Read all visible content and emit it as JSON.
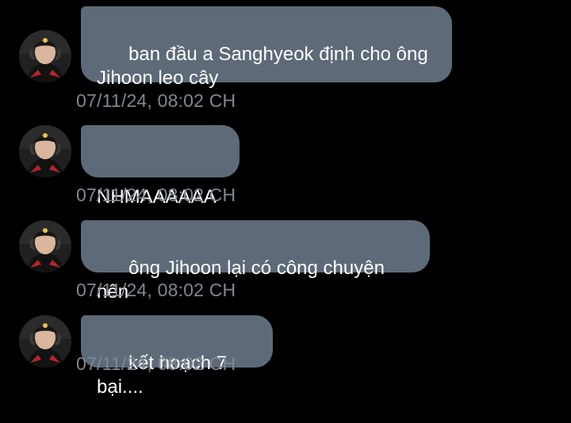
{
  "messages": [
    {
      "avatar_icon": "user-avatar-icon",
      "text": "ban đầu a Sanghyeok định cho ông\nJihoon leo cây",
      "timestamp": "07/11/24, 08:02 CH"
    },
    {
      "avatar_icon": "user-avatar-icon",
      "text": "NHMAAAAAA",
      "timestamp": "07/11/24, 08:02 CH"
    },
    {
      "avatar_icon": "user-avatar-icon",
      "text": "ông Jihoon lại có công chuyện nên",
      "timestamp": "07/11/24, 08:02 CH"
    },
    {
      "avatar_icon": "user-avatar-icon",
      "text": "kết hoạch 7 bại....",
      "timestamp": "07/11/24, 08:02 CH"
    }
  ],
  "colors": {
    "background": "#000000",
    "bubble": "#5e6a78",
    "bubble_text": "#ffffff",
    "timestamp": "#7f8792"
  }
}
